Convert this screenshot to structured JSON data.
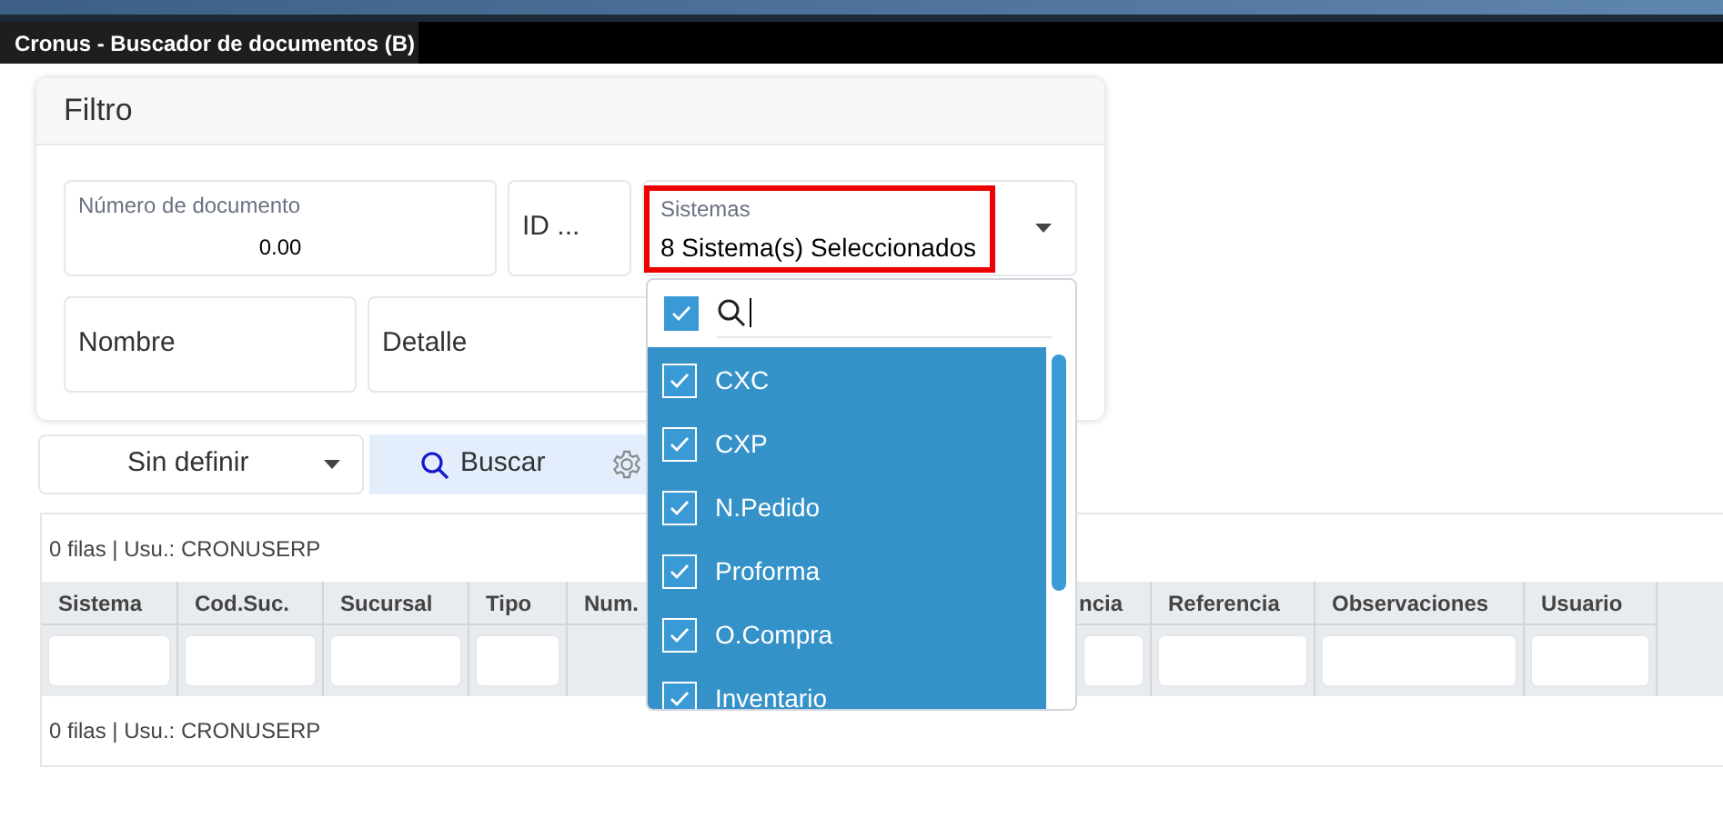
{
  "window": {
    "title": "Cronus - Buscador de documentos (B)"
  },
  "filter": {
    "title": "Filtro",
    "document_number": {
      "label": "Número de documento",
      "value": "0.00"
    },
    "id_field": {
      "label": "ID ..."
    },
    "systems": {
      "label": "Sistemas",
      "value": "8 Sistema(s) Seleccionados",
      "expanded": true,
      "select_all_checked": true,
      "options": [
        {
          "label": "CXC",
          "checked": true
        },
        {
          "label": "CXP",
          "checked": true
        },
        {
          "label": "N.Pedido",
          "checked": true
        },
        {
          "label": "Proforma",
          "checked": true
        },
        {
          "label": "O.Compra",
          "checked": true
        },
        {
          "label": "Inventario",
          "checked": true
        }
      ]
    },
    "name_field": {
      "label": "Nombre"
    },
    "detail_field": {
      "label": "Detalle"
    }
  },
  "toolbar": {
    "preset": "Sin definir",
    "search_button": "Buscar"
  },
  "results": {
    "summary_top": "0 filas | Usu.: CRONUSERP",
    "columns": [
      {
        "label": "Sistema",
        "kind": "filtered"
      },
      {
        "label": "Cod.Suc.",
        "kind": "filtered"
      },
      {
        "label": "Sucursal",
        "kind": "filtered"
      },
      {
        "label": "Tipo",
        "kind": "filtered"
      },
      {
        "label": "Num.",
        "kind": "plain"
      },
      {
        "label": "ncia",
        "kind": "filtered"
      },
      {
        "label": "Referencia",
        "kind": "filtered"
      },
      {
        "label": "Observaciones",
        "kind": "filtered"
      },
      {
        "label": "Usuario",
        "kind": "filtered"
      }
    ],
    "summary_bottom": "0 filas | Usu.: CRONUSERP"
  }
}
